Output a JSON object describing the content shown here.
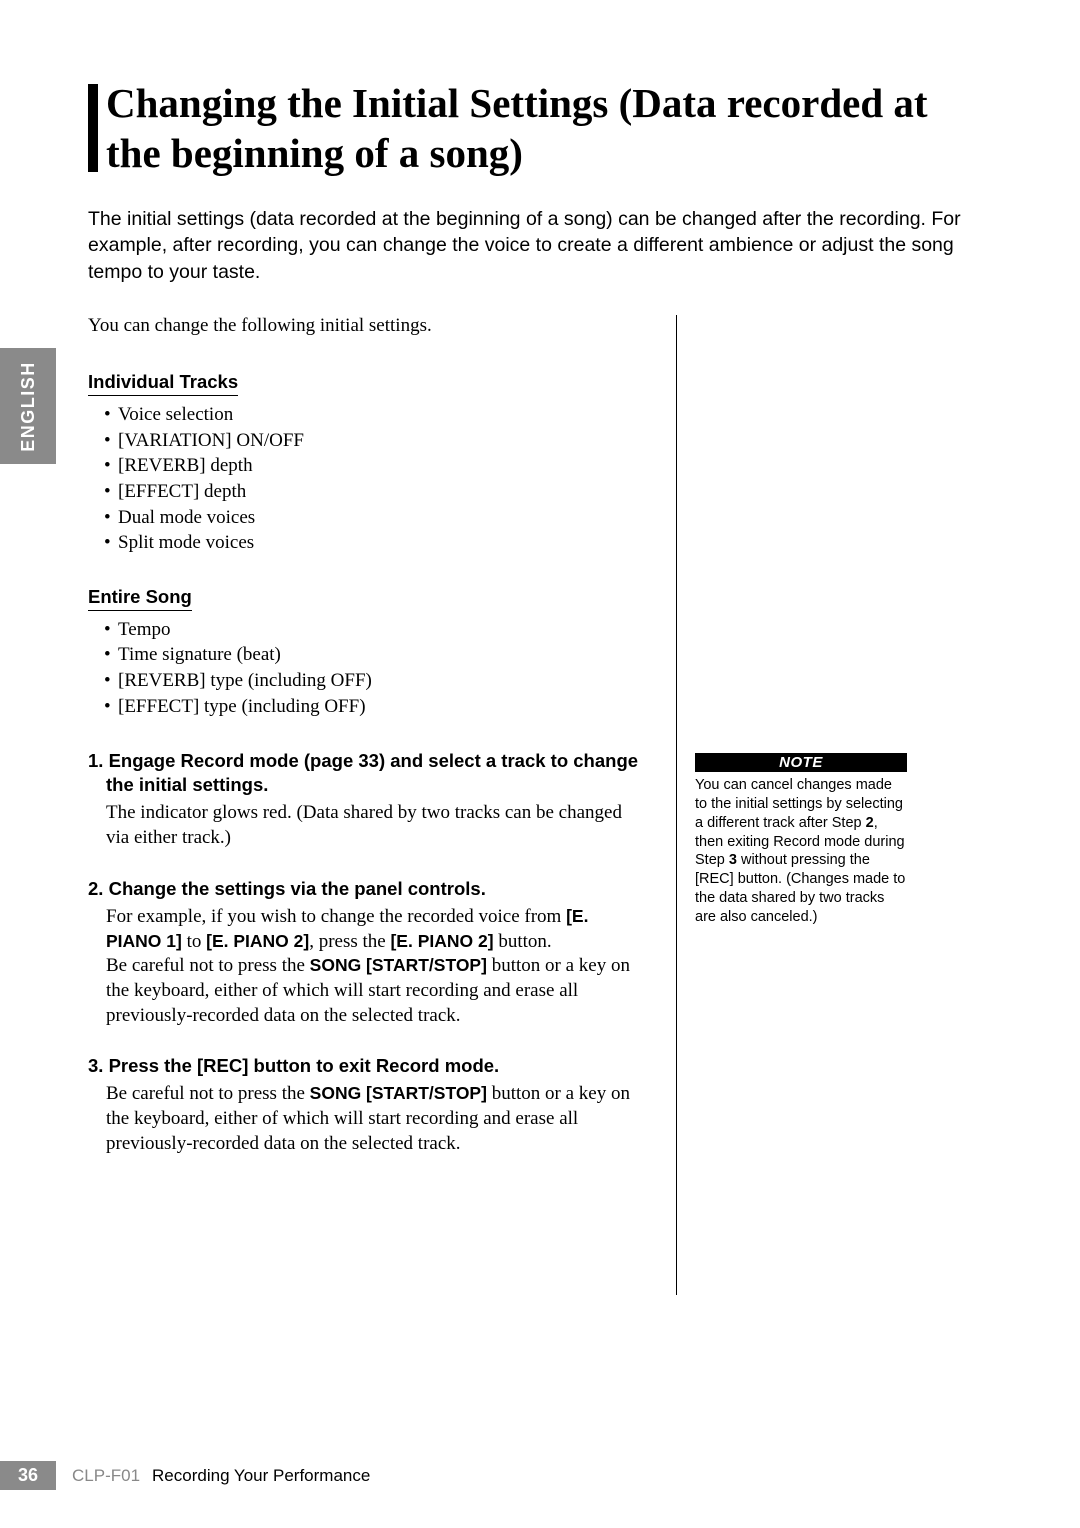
{
  "language_tab": "ENGLISH",
  "title": "Changing the Initial Settings (Data recorded at the beginning of a song)",
  "intro": "The initial settings (data recorded at the beginning of a song) can be changed after the recording. For example, after recording, you can change the voice to create a different ambience or adjust the song tempo to your taste.",
  "lead": "You can change the following initial settings.",
  "section1": {
    "heading": "Individual Tracks",
    "items": [
      "Voice selection",
      "[VARIATION] ON/OFF",
      "[REVERB] depth",
      "[EFFECT] depth",
      "Dual mode voices",
      "Split mode voices"
    ]
  },
  "section2": {
    "heading": "Entire Song",
    "items": [
      "Tempo",
      "Time signature (beat)",
      "[REVERB] type (including OFF)",
      "[EFFECT] type (including OFF)"
    ]
  },
  "steps": [
    {
      "n": "1.",
      "title": "Engage Record mode (page 33) and select a track to change the initial settings.",
      "body_plain": "The indicator glows red. (Data shared by two tracks can be changed via either track.)"
    },
    {
      "n": "2.",
      "title": "Change the settings via the panel controls.",
      "body_pre": "For example, if you wish to change the recorded voice from ",
      "b1": "[E. PIANO 1]",
      "body_mid1": " to ",
      "b2": "[E. PIANO 2]",
      "body_mid2": ", press the ",
      "b3": "[E. PIANO 2]",
      "body_mid3": " button.",
      "body_post1": "Be careful not to press the ",
      "b4": "SONG [START/STOP]",
      "body_post2": " button or a key on the keyboard, either of which will start recording and erase all previously-recorded data on the selected track."
    },
    {
      "n": "3.",
      "title": "Press the [REC] button to exit Record mode.",
      "body_post1": "Be careful not to press the ",
      "b4": "SONG [START/STOP]",
      "body_post2": " button or a key on the keyboard, either of which will start recording and erase all previously-recorded data on the selected track."
    }
  ],
  "note": {
    "header": "NOTE",
    "pre": "You can cancel changes made to the initial settings by selecting a different track after Step ",
    "b1": "2",
    "mid": ", then exiting Record mode during Step ",
    "b2": "3",
    "post": " without pressing the [REC] button. (Changes made to the data shared by two tracks are also canceled.)"
  },
  "footer": {
    "page": "36",
    "model": "CLP-F01",
    "section": "Recording Your Performance"
  }
}
